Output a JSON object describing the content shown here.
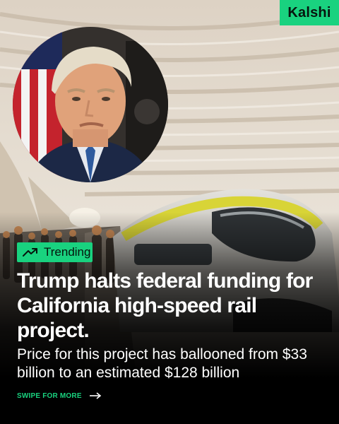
{
  "brand": {
    "name": "Kalshi",
    "color": "#19d27f"
  },
  "badge": {
    "label": "Trending",
    "icon": "trending-up-icon"
  },
  "headline": "Trump halts federal funding for California high-speed rail project.",
  "subtext": "Price for this project has ballooned from $33 billion to an estimated $128 billion",
  "cta": {
    "label": "SWIPE FOR MORE",
    "icon": "arrow-right-icon"
  }
}
